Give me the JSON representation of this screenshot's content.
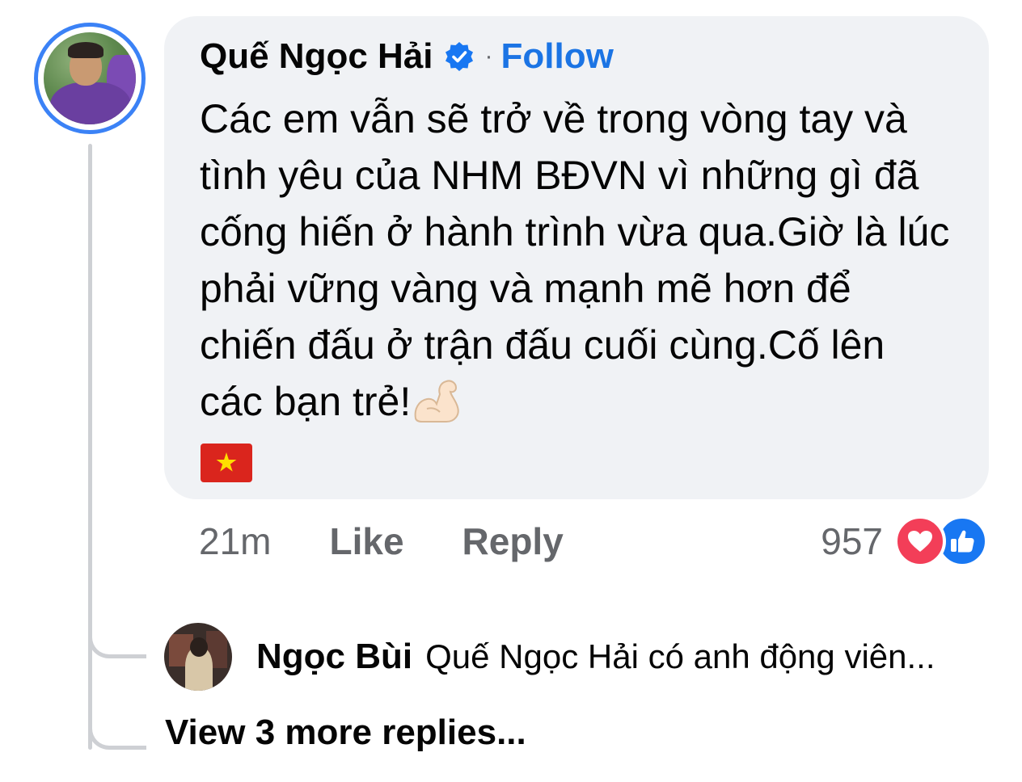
{
  "comment": {
    "author": "Quế Ngọc Hải",
    "separator": "·",
    "follow_label": "Follow",
    "text": "Các em vẫn sẽ trở về trong vòng tay và tình yêu của NHM BĐVN vì những gì đã cống hiến ở hành trình vừa qua.Giờ là lúc phải vững vàng và mạnh mẽ hơn để chiến đấu ở trận đấu cuối cùng.Cố lên các bạn trẻ!",
    "emoji_icons": [
      "flexed-biceps-icon",
      "vietnam-flag-icon"
    ],
    "time": "21m",
    "like_label": "Like",
    "reply_label": "Reply",
    "reaction_count": "957",
    "reaction_icons": [
      "heart-icon",
      "thumbs-up-icon"
    ]
  },
  "reply": {
    "author": "Ngọc Bùi",
    "snippet": "Quế Ngọc Hải có anh động viên..."
  },
  "view_more_label": "View 3 more replies...",
  "colors": {
    "link_blue": "#1b74e4",
    "verified_blue": "#1877f2",
    "heart_red": "#f33e58",
    "bubble_bg": "#f0f2f5",
    "muted_text": "#65676b",
    "avatar_ring": "#3b82f6"
  }
}
